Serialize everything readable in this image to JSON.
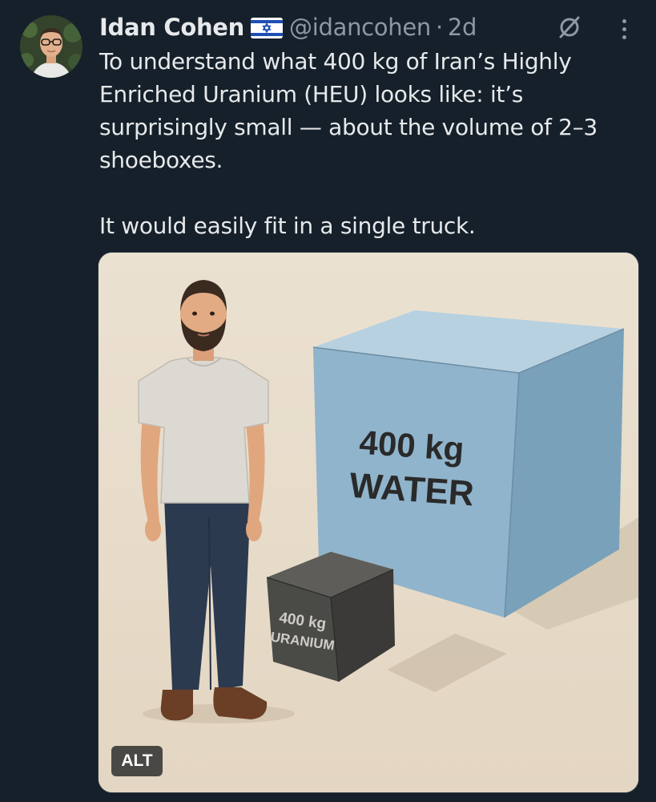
{
  "tweet": {
    "author_name": "Idan Cohen",
    "handle": "@idancohen",
    "separator": "·",
    "time": "2d",
    "paragraphs": [
      "To understand what 400 kg of Iran’s Highly Enriched Uranium (HEU) looks like: it’s surprisingly small — about the volume of 2–3 shoeboxes.",
      "It would easily fit in a single truck."
    ]
  },
  "media": {
    "big_cube_line1": "400 kg",
    "big_cube_line2": "WATER",
    "small_cube_line1": "400 kg",
    "small_cube_line2": "URANIUM",
    "alt_badge": "ALT"
  },
  "icons": {
    "flag": "israel-flag-icon",
    "grok": "grok-icon",
    "more": "more-options-icon"
  },
  "colors": {
    "background": "#15202b",
    "text": "#e7e9ea",
    "secondary": "#8b98a5",
    "water_cube": "#8fb4cc",
    "uranium_cube": "#4a4a47",
    "image_bg": "#e7dbc9"
  }
}
